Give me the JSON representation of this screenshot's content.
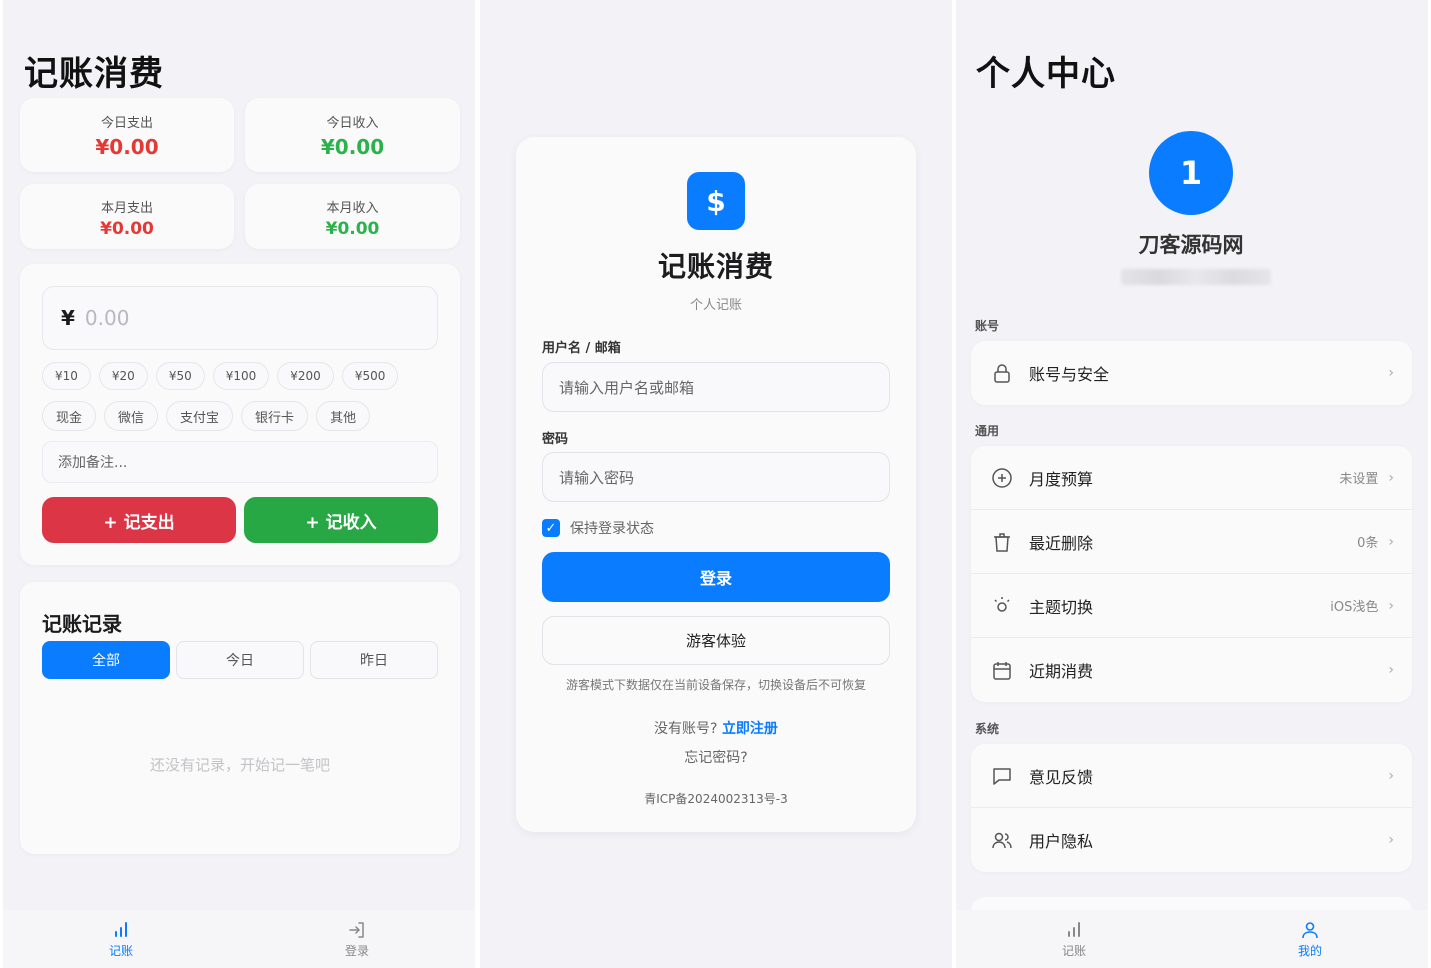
{
  "ledger": {
    "title": "记账消费",
    "stats": [
      {
        "label": "今日支出",
        "value": "¥0.00"
      },
      {
        "label": "今日收入",
        "value": "¥0.00"
      },
      {
        "label": "本月支出",
        "value": "¥0.00"
      },
      {
        "label": "本月收入",
        "value": "¥0.00"
      }
    ],
    "amount": {
      "symbol": "¥",
      "placeholder": "0.00"
    },
    "quick_amounts": [
      "¥10",
      "¥20",
      "¥50",
      "¥100",
      "¥200",
      "¥500"
    ],
    "payment_methods": [
      "现金",
      "微信",
      "支付宝",
      "银行卡",
      "其他"
    ],
    "note_placeholder": "添加备注...",
    "expense_button": "+ 记支出",
    "income_button": "+ 记收入",
    "records": {
      "title": "记账记录",
      "filters": [
        "全部",
        "今日",
        "昨日"
      ],
      "empty": "还没有记录，开始记一笔吧"
    },
    "tabs": [
      "记账",
      "登录"
    ]
  },
  "login": {
    "logo_symbol": "$",
    "title": "记账消费",
    "subtitle": "个人记账",
    "username_label": "用户名 / 邮箱",
    "username_placeholder": "请输入用户名或邮箱",
    "password_label": "密码",
    "password_placeholder": "请输入密码",
    "remember": "保持登录状态",
    "login_button": "登录",
    "guest_button": "游客体验",
    "guest_note": "游客模式下数据仅在当前设备保存，切换设备后不可恢复",
    "no_account": "没有账号?",
    "register": "立即注册",
    "forgot": "忘记密码?",
    "icp": "青ICP备2024002313号-3"
  },
  "profile": {
    "title": "个人中心",
    "avatar_text": "1",
    "username": "刀客源码网",
    "sections": {
      "account": "账号",
      "general": "通用",
      "system": "系统"
    },
    "account_items": [
      {
        "label": "账号与安全",
        "value": ""
      }
    ],
    "general_items": [
      {
        "label": "月度预算",
        "value": "未设置"
      },
      {
        "label": "最近删除",
        "value": "0条"
      },
      {
        "label": "主题切换",
        "value": "iOS浅色"
      },
      {
        "label": "近期消费",
        "value": ""
      }
    ],
    "system_items": [
      {
        "label": "意见反馈",
        "value": ""
      },
      {
        "label": "用户隐私",
        "value": ""
      }
    ],
    "tabs": [
      "记账",
      "我的"
    ]
  },
  "colors": {
    "primary": "#0a7cff",
    "expense": "#dc3545",
    "income": "#28a745",
    "background": "#f2f2f7"
  }
}
